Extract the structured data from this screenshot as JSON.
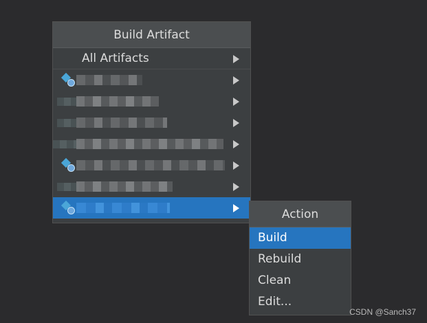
{
  "popup": {
    "title": "Build Artifact",
    "all_artifacts_label": "All Artifacts",
    "artifact_count": 7,
    "selected_index": 6
  },
  "submenu": {
    "title": "Action",
    "items": [
      "Build",
      "Rebuild",
      "Clean",
      "Edit..."
    ],
    "selected_index": 0
  },
  "watermark": "CSDN @Sanch37",
  "colors": {
    "background": "#2b2b2d",
    "popup_bg": "#3c3f41",
    "header_bg": "#4b4e50",
    "selection": "#2675bf",
    "text": "#dcdcdc"
  },
  "icons": {
    "artifact": "artifact-icon",
    "submenu_arrow": "arrow-right-icon"
  }
}
